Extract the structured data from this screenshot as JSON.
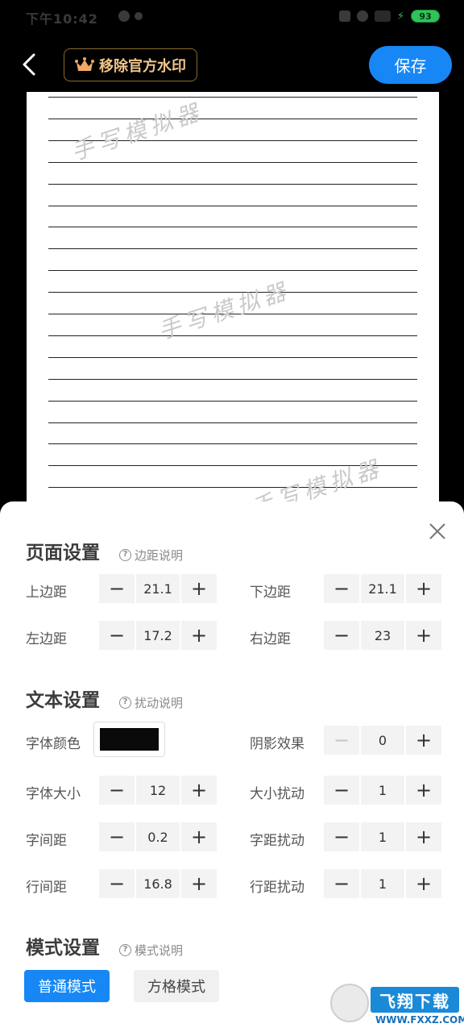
{
  "status_bar": {
    "time": "下午10:42",
    "battery": "93"
  },
  "toolbar": {
    "remove_watermark_label": "移除官方水印",
    "save_label": "保存"
  },
  "paper": {
    "watermark_text": "手写模拟器",
    "line_count": 19
  },
  "page_settings": {
    "title": "页面设置",
    "help": "边距说明",
    "top_margin": {
      "label": "上边距",
      "value": "21.1"
    },
    "bottom_margin": {
      "label": "下边距",
      "value": "21.1"
    },
    "left_margin": {
      "label": "左边距",
      "value": "17.2"
    },
    "right_margin": {
      "label": "右边距",
      "value": "23"
    }
  },
  "text_settings": {
    "title": "文本设置",
    "help": "扰动说明",
    "font_color": {
      "label": "字体颜色",
      "color": "#0a0a0a"
    },
    "shadow": {
      "label": "阴影效果",
      "value": "0"
    },
    "font_size": {
      "label": "字体大小",
      "value": "12"
    },
    "size_jitter": {
      "label": "大小扰动",
      "value": "1"
    },
    "letter_spacing": {
      "label": "字间距",
      "value": "0.2"
    },
    "spacing_jitter": {
      "label": "字距扰动",
      "value": "1"
    },
    "line_spacing": {
      "label": "行间距",
      "value": "16.8"
    },
    "line_jitter": {
      "label": "行距扰动",
      "value": "1"
    }
  },
  "mode_settings": {
    "title": "模式设置",
    "help": "模式说明",
    "normal_mode": "普通模式",
    "grid_mode": "方格模式"
  },
  "badge": {
    "logo_text": "飞翔下载",
    "url": "WWW.FXXZ.COM"
  },
  "colors": {
    "accent": "#1787f5",
    "gold": "#f0c58a"
  }
}
